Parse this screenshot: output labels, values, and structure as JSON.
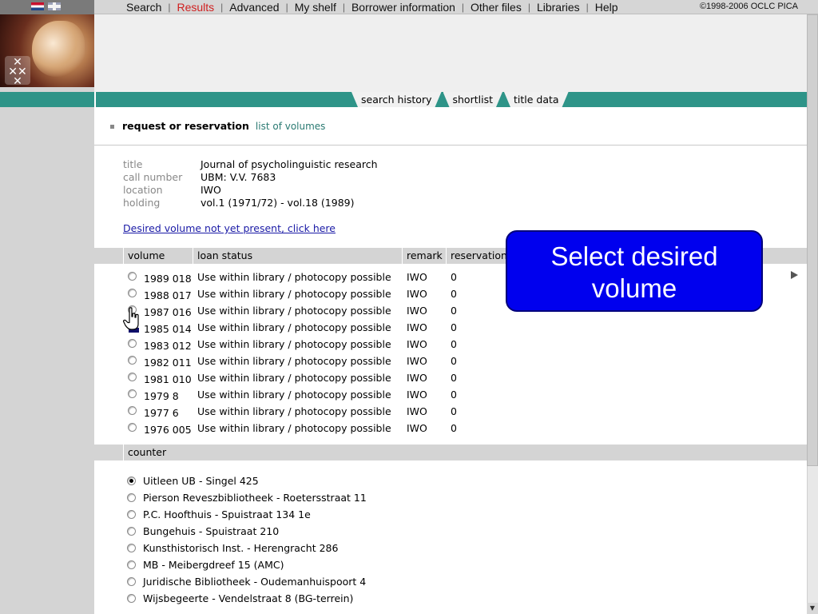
{
  "nav": {
    "items": [
      {
        "label": "Search",
        "active": false
      },
      {
        "label": "Results",
        "active": true
      },
      {
        "label": "Advanced",
        "active": false
      },
      {
        "label": "My shelf",
        "active": false
      },
      {
        "label": "Borrower information",
        "active": false
      },
      {
        "label": "Other files",
        "active": false
      },
      {
        "label": "Libraries",
        "active": false
      },
      {
        "label": "Help",
        "active": false
      }
    ],
    "copyright": "©1998-2006 OCLC PICA"
  },
  "tabs": [
    "search history",
    "shortlist",
    "title data"
  ],
  "request": {
    "label": "request or reservation",
    "list_link": "list of volumes"
  },
  "title_info": {
    "title_key": "title",
    "title": "Journal of psycholinguistic research",
    "call_key": "call number",
    "call_number": "UBM: V.V. 7683",
    "location_key": "location",
    "location": "IWO",
    "holding_key": "holding",
    "holding": "vol.1 (1971/72) - vol.18 (1989)"
  },
  "not_present_link": "Desired volume not yet present, click here",
  "volume_table": {
    "headers": [
      "volume",
      "loan status",
      "remark",
      "reservation"
    ],
    "rows": [
      {
        "volume": "1989 018",
        "loan": "Use within library / photocopy possible",
        "remark": "IWO",
        "reservations": "0"
      },
      {
        "volume": "1988 017",
        "loan": "Use within library / photocopy possible",
        "remark": "IWO",
        "reservations": "0"
      },
      {
        "volume": "1987 016",
        "loan": "Use within library / photocopy possible",
        "remark": "IWO",
        "reservations": "0"
      },
      {
        "volume": "1985 014",
        "loan": "Use within library / photocopy possible",
        "remark": "IWO",
        "reservations": "0"
      },
      {
        "volume": "1983 012",
        "loan": "Use within library / photocopy possible",
        "remark": "IWO",
        "reservations": "0"
      },
      {
        "volume": "1982 011",
        "loan": "Use within library / photocopy possible",
        "remark": "IWO",
        "reservations": "0"
      },
      {
        "volume": "1981 010",
        "loan": "Use within library / photocopy possible",
        "remark": "IWO",
        "reservations": "0"
      },
      {
        "volume": "1979 8",
        "loan": "Use within library / photocopy possible",
        "remark": "IWO",
        "reservations": "0"
      },
      {
        "volume": "1977 6",
        "loan": "Use within library / photocopy possible",
        "remark": "IWO",
        "reservations": "0"
      },
      {
        "volume": "1976 005",
        "loan": "Use within library / photocopy possible",
        "remark": "IWO",
        "reservations": "0"
      }
    ]
  },
  "callout": {
    "line1": "Select desired",
    "line2": "volume"
  },
  "counter": {
    "header": "counter",
    "options": [
      {
        "label": "Uitleen UB - Singel 425",
        "checked": true
      },
      {
        "label": "Pierson Reveszbibliotheek - Roetersstraat 11",
        "checked": false
      },
      {
        "label": "P.C. Hoofthuis - Spuistraat 134 1e",
        "checked": false
      },
      {
        "label": "Bungehuis - Spuistraat 210",
        "checked": false
      },
      {
        "label": "Kunsthistorisch Inst. - Herengracht 286",
        "checked": false
      },
      {
        "label": "MB - Meibergdreef 15 (AMC)",
        "checked": false
      },
      {
        "label": "Juridische Bibliotheek - Oudemanhuispoort 4",
        "checked": false
      },
      {
        "label": "Wijsbegeerte - Vendelstraat 8 (BG-terrein)",
        "checked": false
      }
    ]
  },
  "colors": {
    "teal_band": "#2e9488",
    "callout_bg": "#0000ee",
    "active_nav": "#d02020",
    "link": "#1a1aa6"
  }
}
